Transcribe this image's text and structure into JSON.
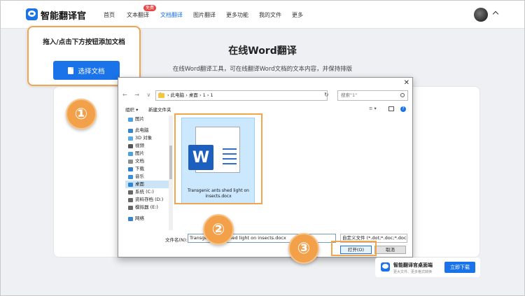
{
  "app": {
    "name": "智能翻译官"
  },
  "nav": {
    "items": [
      "首页",
      "文本翻译",
      "文档翻译",
      "图片翻译",
      "更多功能",
      "我的文件",
      "更多"
    ],
    "badge": "免费"
  },
  "page": {
    "title": "在线Word翻译",
    "subtitle": "在线Word翻译工具，可在线翻译Word文档的文本内容，并保持排版"
  },
  "tip": {
    "text": "拖入/点击下方按钮添加文档",
    "button": "选择文档"
  },
  "callouts": [
    "①",
    "②",
    "③"
  ],
  "dialog": {
    "close": "✕",
    "breadcrumb": "›  此电脑  ›  桌面  ›  1  ›  1",
    "search_placeholder": "搜索\"1\"",
    "organize": "组织 ▾",
    "new_folder": "新建文件夹",
    "sidebar": [
      "图片",
      "此电脑",
      "3D 对象",
      "视频",
      "图片",
      "文档",
      "下载",
      "音乐",
      "桌面",
      "系统 (C:)",
      "资料存档 (D:)",
      "模拟器 (E:)",
      "网络"
    ],
    "selected_sidebar": "桌面",
    "file": {
      "icon_letter": "W",
      "name": "Transgenic ants shed light on insects.docx"
    },
    "filename_label": "文件名(N):",
    "filename_value": "Transgenic ants shed light on insects.docx",
    "filetype": "自定义文件 (*.dot;*.doc;*.docx)",
    "open": "打开(O)",
    "cancel": "取消"
  },
  "promo": {
    "title": "智能翻译官桌面端",
    "subtitle": "更大文件、更多格式转换",
    "button": "立即下载"
  },
  "colors": {
    "accent": "#1a73e8",
    "callout": "#f2a04a"
  }
}
